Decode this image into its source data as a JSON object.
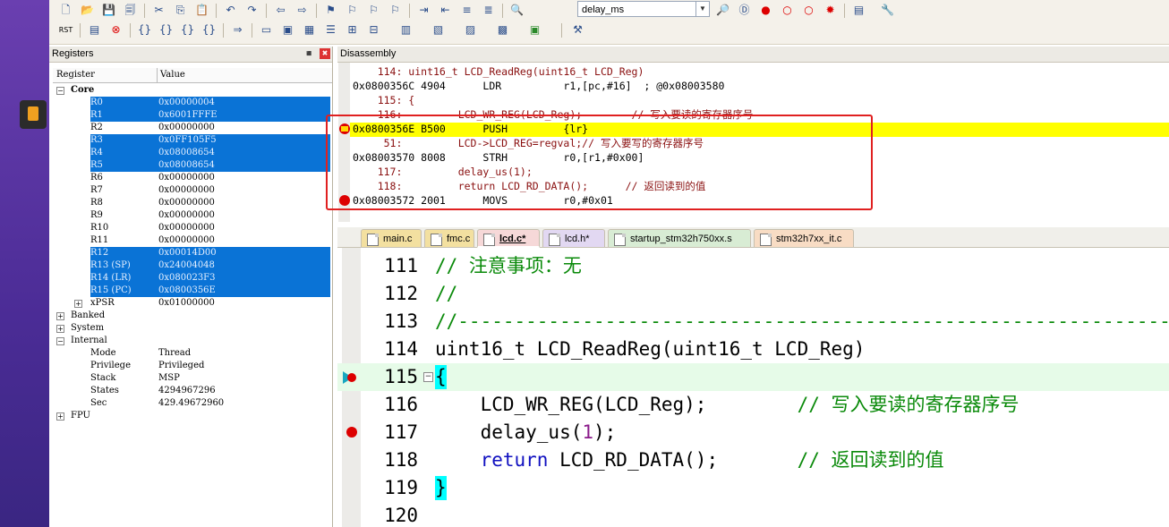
{
  "toolbar": {
    "target_combo_value": "delay_ms"
  },
  "registers_panel": {
    "title": "Registers",
    "pin_glyph": "◾",
    "close_glyph": "✖",
    "col_register": "Register",
    "col_value": "Value",
    "rows": [
      {
        "name": "Core",
        "value": "",
        "level": 0,
        "toggle": "−",
        "bold": true,
        "sel": false
      },
      {
        "name": "R0",
        "value": "0x00000004",
        "level": 2,
        "sel": true
      },
      {
        "name": "R1",
        "value": "0x6001FFFE",
        "level": 2,
        "sel": true
      },
      {
        "name": "R2",
        "value": "0x00000000",
        "level": 2,
        "sel": false
      },
      {
        "name": "R3",
        "value": "0x0FF105F5",
        "level": 2,
        "sel": true
      },
      {
        "name": "R4",
        "value": "0x08008654",
        "level": 2,
        "sel": true
      },
      {
        "name": "R5",
        "value": "0x08008654",
        "level": 2,
        "sel": true
      },
      {
        "name": "R6",
        "value": "0x00000000",
        "level": 2,
        "sel": false
      },
      {
        "name": "R7",
        "value": "0x00000000",
        "level": 2,
        "sel": false
      },
      {
        "name": "R8",
        "value": "0x00000000",
        "level": 2,
        "sel": false
      },
      {
        "name": "R9",
        "value": "0x00000000",
        "level": 2,
        "sel": false
      },
      {
        "name": "R10",
        "value": "0x00000000",
        "level": 2,
        "sel": false
      },
      {
        "name": "R11",
        "value": "0x00000000",
        "level": 2,
        "sel": false
      },
      {
        "name": "R12",
        "value": "0x00014D00",
        "level": 2,
        "sel": true
      },
      {
        "name": "R13 (SP)",
        "value": "0x24004048",
        "level": 2,
        "sel": true
      },
      {
        "name": "R14 (LR)",
        "value": "0x080023F3",
        "level": 2,
        "sel": true
      },
      {
        "name": "R15 (PC)",
        "value": "0x0800356E",
        "level": 2,
        "sel": true
      },
      {
        "name": "xPSR",
        "value": "0x01000000",
        "level": 1,
        "toggle": "+",
        "sel": false
      },
      {
        "name": "Banked",
        "value": "",
        "level": 0,
        "toggle": "+",
        "sel": false
      },
      {
        "name": "System",
        "value": "",
        "level": 0,
        "toggle": "+",
        "sel": false
      },
      {
        "name": "Internal",
        "value": "",
        "level": 0,
        "toggle": "−",
        "sel": false
      },
      {
        "name": "Mode",
        "value": "Thread",
        "level": 2,
        "sel": false
      },
      {
        "name": "Privilege",
        "value": "Privileged",
        "level": 2,
        "sel": false
      },
      {
        "name": "Stack",
        "value": "MSP",
        "level": 2,
        "sel": false
      },
      {
        "name": "States",
        "value": "4294967296",
        "level": 2,
        "sel": false
      },
      {
        "name": "Sec",
        "value": "429.49672960",
        "level": 2,
        "sel": false
      },
      {
        "name": "FPU",
        "value": "",
        "level": 0,
        "toggle": "+",
        "sel": false
      }
    ]
  },
  "disassembly": {
    "title": "Disassembly",
    "lines": [
      {
        "text": "    114: uint16_t LCD_ReadReg(uint16_t LCD_Reg)",
        "kind": "src"
      },
      {
        "text": "0x0800356C 4904      LDR          r1,[pc,#16]  ; @0x08003580",
        "kind": "asm"
      },
      {
        "text": "    115: {",
        "kind": "src"
      },
      {
        "text": "    116:         LCD_WR_REG(LCD_Reg);        // 写入要读的寄存器序号",
        "kind": "src"
      },
      {
        "text": "0x0800356E B500      PUSH         {lr}",
        "kind": "asm",
        "current": true
      },
      {
        "text": "     51:         LCD->LCD_REG=regval;// 写入要写的寄存器序号",
        "kind": "src"
      },
      {
        "text": "0x08003570 8008      STRH         r0,[r1,#0x00]",
        "kind": "asm"
      },
      {
        "text": "    117:         delay_us(1);",
        "kind": "src"
      },
      {
        "text": "    118:         return LCD_RD_DATA();      // 返回读到的值",
        "kind": "src"
      },
      {
        "text": "0x08003572 2001      MOVS         r0,#0x01",
        "kind": "asm",
        "breakpoint": true
      }
    ]
  },
  "tabs": [
    {
      "label": "main.c",
      "color": "#f3e0a0",
      "active": false
    },
    {
      "label": "fmc.c",
      "color": "#f3e0a0",
      "active": false
    },
    {
      "label": "lcd.c*",
      "color": "#f6d8d8",
      "active": true
    },
    {
      "label": "lcd.h*",
      "color": "#e2d8f2",
      "active": false
    },
    {
      "label": "startup_stm32h750xx.s",
      "color": "#d8ecd4",
      "active": false
    },
    {
      "label": "stm32h7xx_it.c",
      "color": "#f8dcc4",
      "active": false
    }
  ],
  "editor": {
    "lines": [
      {
        "no": "111",
        "parts": [
          {
            "t": "// 注意事项：无",
            "c": "cm"
          }
        ]
      },
      {
        "no": "112",
        "parts": [
          {
            "t": "//",
            "c": "cm"
          }
        ]
      },
      {
        "no": "113",
        "parts": [
          {
            "t": "//---------------------------------------------------------------------",
            "c": "cm"
          }
        ]
      },
      {
        "no": "114",
        "parts": [
          {
            "t": "uint16_t LCD_ReadReg(uint16_t LCD_Reg)",
            "c": ""
          }
        ]
      },
      {
        "no": "115",
        "parts": [
          {
            "t": "{",
            "c": ""
          }
        ],
        "current": true,
        "fold": "−"
      },
      {
        "no": "116",
        "parts": [
          {
            "t": "    LCD_WR_REG(LCD_Reg);        ",
            "c": ""
          },
          {
            "t": "// 写入要读的寄存器序号",
            "c": "cm"
          }
        ]
      },
      {
        "no": "117",
        "parts": [
          {
            "t": "    delay_us(",
            "c": ""
          },
          {
            "t": "1",
            "c": "num"
          },
          {
            "t": ");",
            "c": ""
          }
        ],
        "breakpoint": true
      },
      {
        "no": "118",
        "parts": [
          {
            "t": "    ",
            "c": ""
          },
          {
            "t": "return",
            "c": "kw"
          },
          {
            "t": " LCD_RD_DATA();       ",
            "c": ""
          },
          {
            "t": "// 返回读到的值",
            "c": "cm"
          }
        ]
      },
      {
        "no": "119",
        "parts": [
          {
            "t": "}",
            "c": ""
          }
        ],
        "brace": true
      },
      {
        "no": "120",
        "parts": [
          {
            "t": "",
            "c": ""
          }
        ]
      }
    ]
  },
  "colors": {
    "selection": "#0a73d6",
    "current_line": "#ffff00",
    "editor_current_line": "#e6fbe8",
    "highlight_box": "#e02020",
    "comment": "#0a8a0a"
  }
}
